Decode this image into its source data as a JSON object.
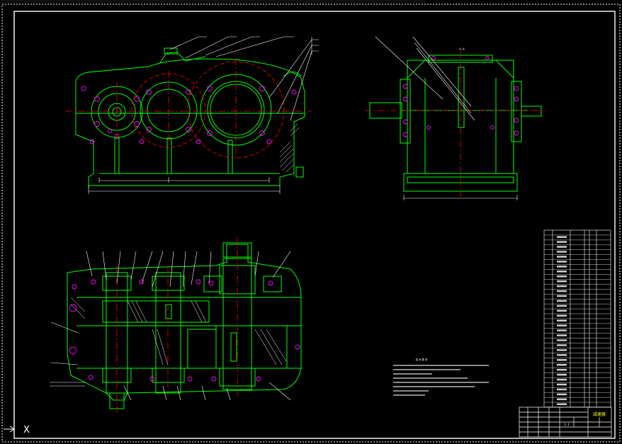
{
  "colors": {
    "background": "#000000",
    "outline": "#00ff00",
    "centerline": "#ff0000",
    "dimension": "#ffffff",
    "leader": "#ffffff",
    "hatch": "#ffffff",
    "hidden_hole": "#ff00ff",
    "gear_circle": "#ff0000"
  },
  "views": {
    "front_view": "front-elevation",
    "side_view": "side-elevation",
    "plan_view": "plan-section"
  },
  "side_view_label": "A-A",
  "ucs_icon": "ucs-axis-icon",
  "ucs_label": "X",
  "tech_requirements_title": "技 术 要 求",
  "title_block": {
    "drawing_name": "减速器",
    "scale_label": "1:1"
  }
}
